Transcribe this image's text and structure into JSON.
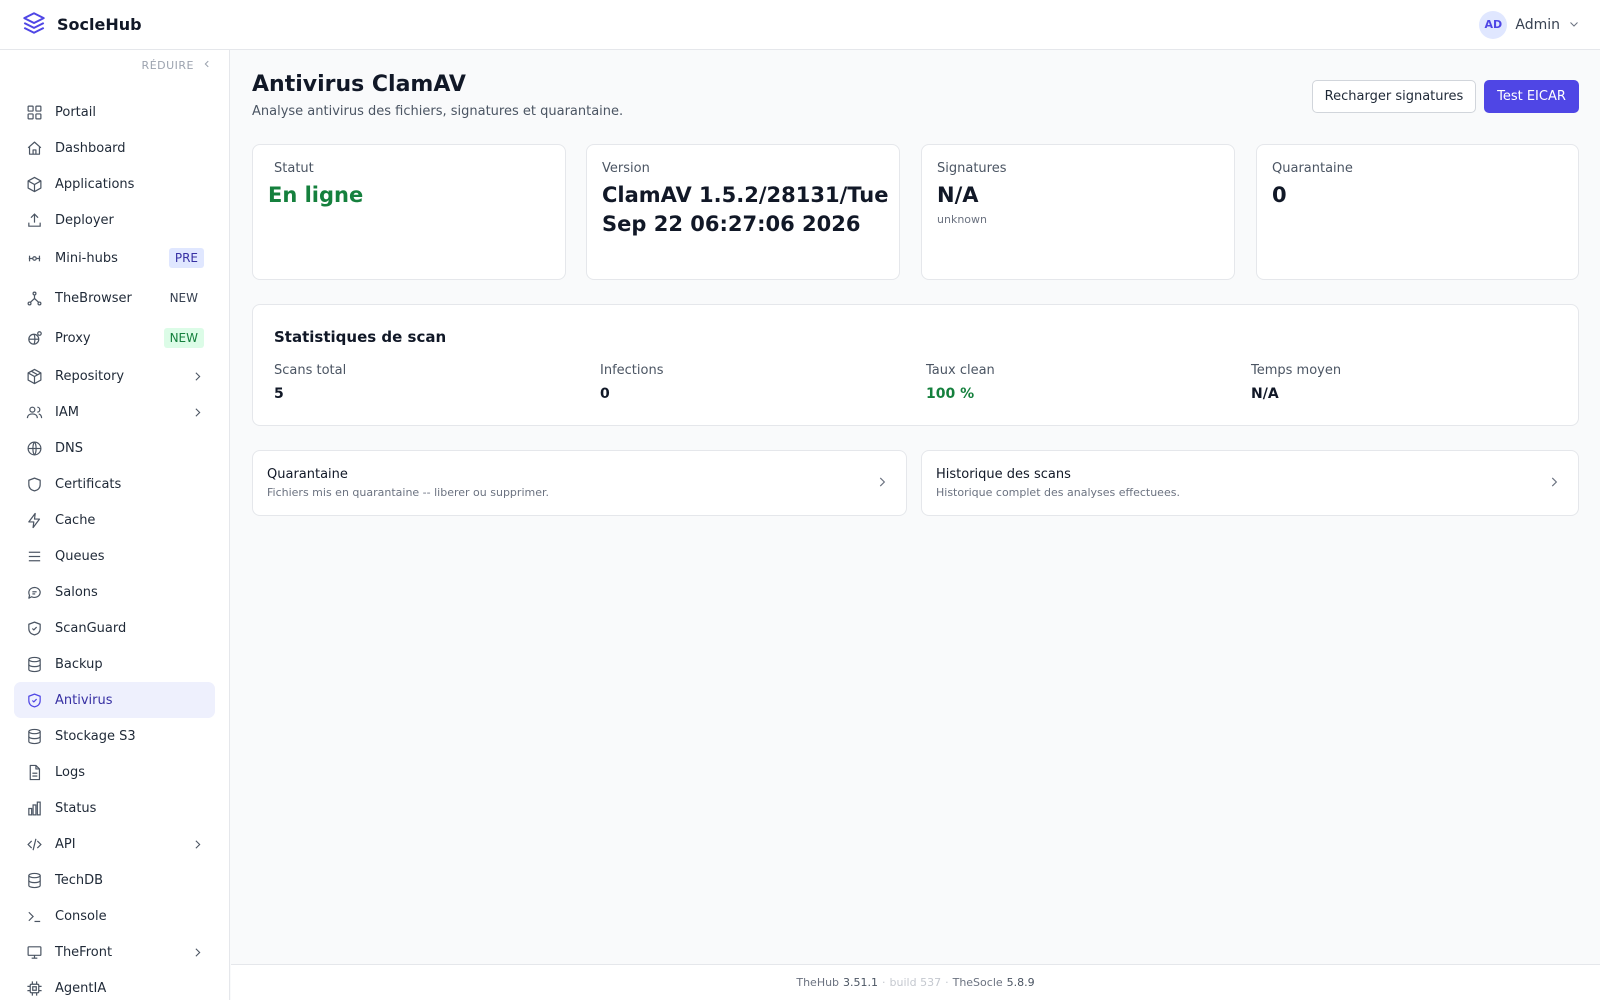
{
  "app": {
    "name": "SocleHub",
    "logo_icon": "layers-icon"
  },
  "user": {
    "initials": "AD",
    "name": "Admin"
  },
  "sidebar": {
    "collapse_label": "RÉDUIRE",
    "items": [
      {
        "label": "Portail",
        "icon": "grid-icon"
      },
      {
        "label": "Dashboard",
        "icon": "home-icon"
      },
      {
        "label": "Applications",
        "icon": "box-icon"
      },
      {
        "label": "Deployer",
        "icon": "upload-icon"
      },
      {
        "label": "Mini-hubs",
        "icon": "sliders-icon",
        "badge": "PRE"
      },
      {
        "label": "TheBrowser",
        "icon": "network-icon",
        "badge": "NEW"
      },
      {
        "label": "Proxy",
        "icon": "globe-gear-icon",
        "badge": "NEW"
      },
      {
        "label": "Repository",
        "icon": "package-icon",
        "expandable": true
      },
      {
        "label": "IAM",
        "icon": "users-icon",
        "expandable": true
      },
      {
        "label": "DNS",
        "icon": "globe-icon"
      },
      {
        "label": "Certificats",
        "icon": "shield-icon"
      },
      {
        "label": "Cache",
        "icon": "bolt-icon"
      },
      {
        "label": "Queues",
        "icon": "list-icon"
      },
      {
        "label": "Salons",
        "icon": "chat-icon"
      },
      {
        "label": "ScanGuard",
        "icon": "shield-check-icon"
      },
      {
        "label": "Backup",
        "icon": "database-icon"
      },
      {
        "label": "Antivirus",
        "icon": "shield-check-icon",
        "active": true
      },
      {
        "label": "Stockage S3",
        "icon": "database-icon"
      },
      {
        "label": "Logs",
        "icon": "file-text-icon"
      },
      {
        "label": "Status",
        "icon": "bar-chart-icon"
      },
      {
        "label": "API",
        "icon": "code-icon",
        "expandable": true
      },
      {
        "label": "TechDB",
        "icon": "database-icon"
      },
      {
        "label": "Console",
        "icon": "terminal-icon"
      },
      {
        "label": "TheFront",
        "icon": "monitor-icon",
        "expandable": true
      },
      {
        "label": "AgentIA",
        "icon": "cpu-icon"
      }
    ]
  },
  "page": {
    "title": "Antivirus ClamAV",
    "subtitle": "Analyse antivirus des fichiers, signatures et quarantaine.",
    "reload_button": "Recharger signatures",
    "test_button": "Test EICAR"
  },
  "stats": {
    "status": {
      "label": "Statut",
      "value": "En ligne"
    },
    "version": {
      "label": "Version",
      "value": "ClamAV 1.5.2/28131/Tue Sep 22 06:27:06 2026"
    },
    "signatures": {
      "label": "Signatures",
      "value": "N/A",
      "sub": "unknown"
    },
    "quarantine": {
      "label": "Quarantaine",
      "value": "0"
    }
  },
  "scan_stats": {
    "title": "Statistiques de scan",
    "total": {
      "label": "Scans total",
      "value": "5"
    },
    "infections": {
      "label": "Infections",
      "value": "0"
    },
    "clean_rate": {
      "label": "Taux clean",
      "value": "100 %"
    },
    "avg_time": {
      "label": "Temps moyen",
      "value": "N/A"
    }
  },
  "links": {
    "quarantine": {
      "title": "Quarantaine",
      "desc": "Fichiers mis en quarantaine -- liberer ou supprimer."
    },
    "history": {
      "title": "Historique des scans",
      "desc": "Historique complet des analyses effectuees."
    }
  },
  "footer": {
    "hub_label": "TheHub",
    "hub_version": "3.51.1",
    "build": "build 537",
    "socle_label": "TheSocle",
    "socle_version": "5.8.9"
  },
  "colors": {
    "accent": "#4f46e5",
    "success": "#15803d",
    "active_bg": "#eef0fd"
  }
}
